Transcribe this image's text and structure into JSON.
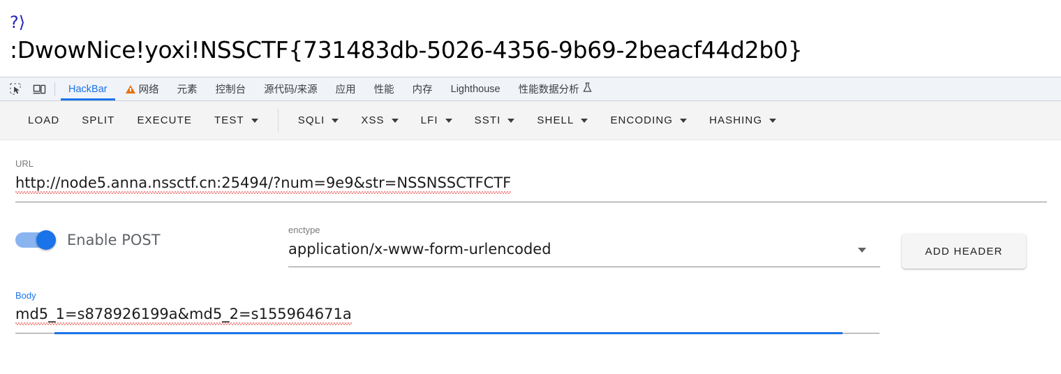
{
  "page": {
    "php_glyph": "?⟩",
    "flag_text": ":DwowNice!yoxi!NSSCTF{731483db-5026-4356-9b69-2beacf44d2b0}"
  },
  "devtools": {
    "icons": [
      {
        "name": "inspect-element-icon",
        "label": "Inspect"
      },
      {
        "name": "device-toolbar-icon",
        "label": "Toggle device toolbar"
      }
    ],
    "tabs": [
      {
        "label": "HackBar",
        "active": true,
        "warning": false
      },
      {
        "label": "网络",
        "active": false,
        "warning": true
      },
      {
        "label": "元素",
        "active": false,
        "warning": false
      },
      {
        "label": "控制台",
        "active": false,
        "warning": false
      },
      {
        "label": "源代码/来源",
        "active": false,
        "warning": false
      },
      {
        "label": "应用",
        "active": false,
        "warning": false
      },
      {
        "label": "性能",
        "active": false,
        "warning": false
      },
      {
        "label": "内存",
        "active": false,
        "warning": false
      },
      {
        "label": "Lighthouse",
        "active": false,
        "warning": false
      },
      {
        "label": "性能数据分析",
        "active": false,
        "warning": false,
        "trailing_icon": "flask-icon",
        "trailing_glyph": "⨃"
      }
    ]
  },
  "hackbar": {
    "buttons": [
      {
        "label": "LOAD",
        "dropdown": false
      },
      {
        "label": "SPLIT",
        "dropdown": false
      },
      {
        "label": "EXECUTE",
        "dropdown": false
      },
      {
        "label": "TEST",
        "dropdown": true
      },
      {
        "divider": true
      },
      {
        "label": "SQLI",
        "dropdown": true
      },
      {
        "label": "XSS",
        "dropdown": true
      },
      {
        "label": "LFI",
        "dropdown": true
      },
      {
        "label": "SSTI",
        "dropdown": true
      },
      {
        "label": "SHELL",
        "dropdown": true
      },
      {
        "label": "ENCODING",
        "dropdown": true
      },
      {
        "label": "HASHING",
        "dropdown": true
      }
    ]
  },
  "form": {
    "url_field": {
      "label": "URL",
      "value": "http://node5.anna.nssctf.cn:25494/?num=9e9&str=NSSNSSCTFCTF"
    },
    "post_toggle": {
      "label": "Enable POST",
      "enabled": true
    },
    "enctype_field": {
      "label": "enctype",
      "value": "application/x-www-form-urlencoded"
    },
    "add_header_button": {
      "label": "ADD HEADER"
    },
    "body_field": {
      "label": "Body",
      "value": "md5_1=s878926199a&md5_2=s155964671a",
      "focused": true
    }
  },
  "colors": {
    "accent_blue": "#1a73e8",
    "warning_orange": "#e8710a",
    "devtools_bg": "#f0f3f8",
    "toolbar_bg": "#f4f4f4",
    "spellcheck_red": "#ee2222"
  }
}
